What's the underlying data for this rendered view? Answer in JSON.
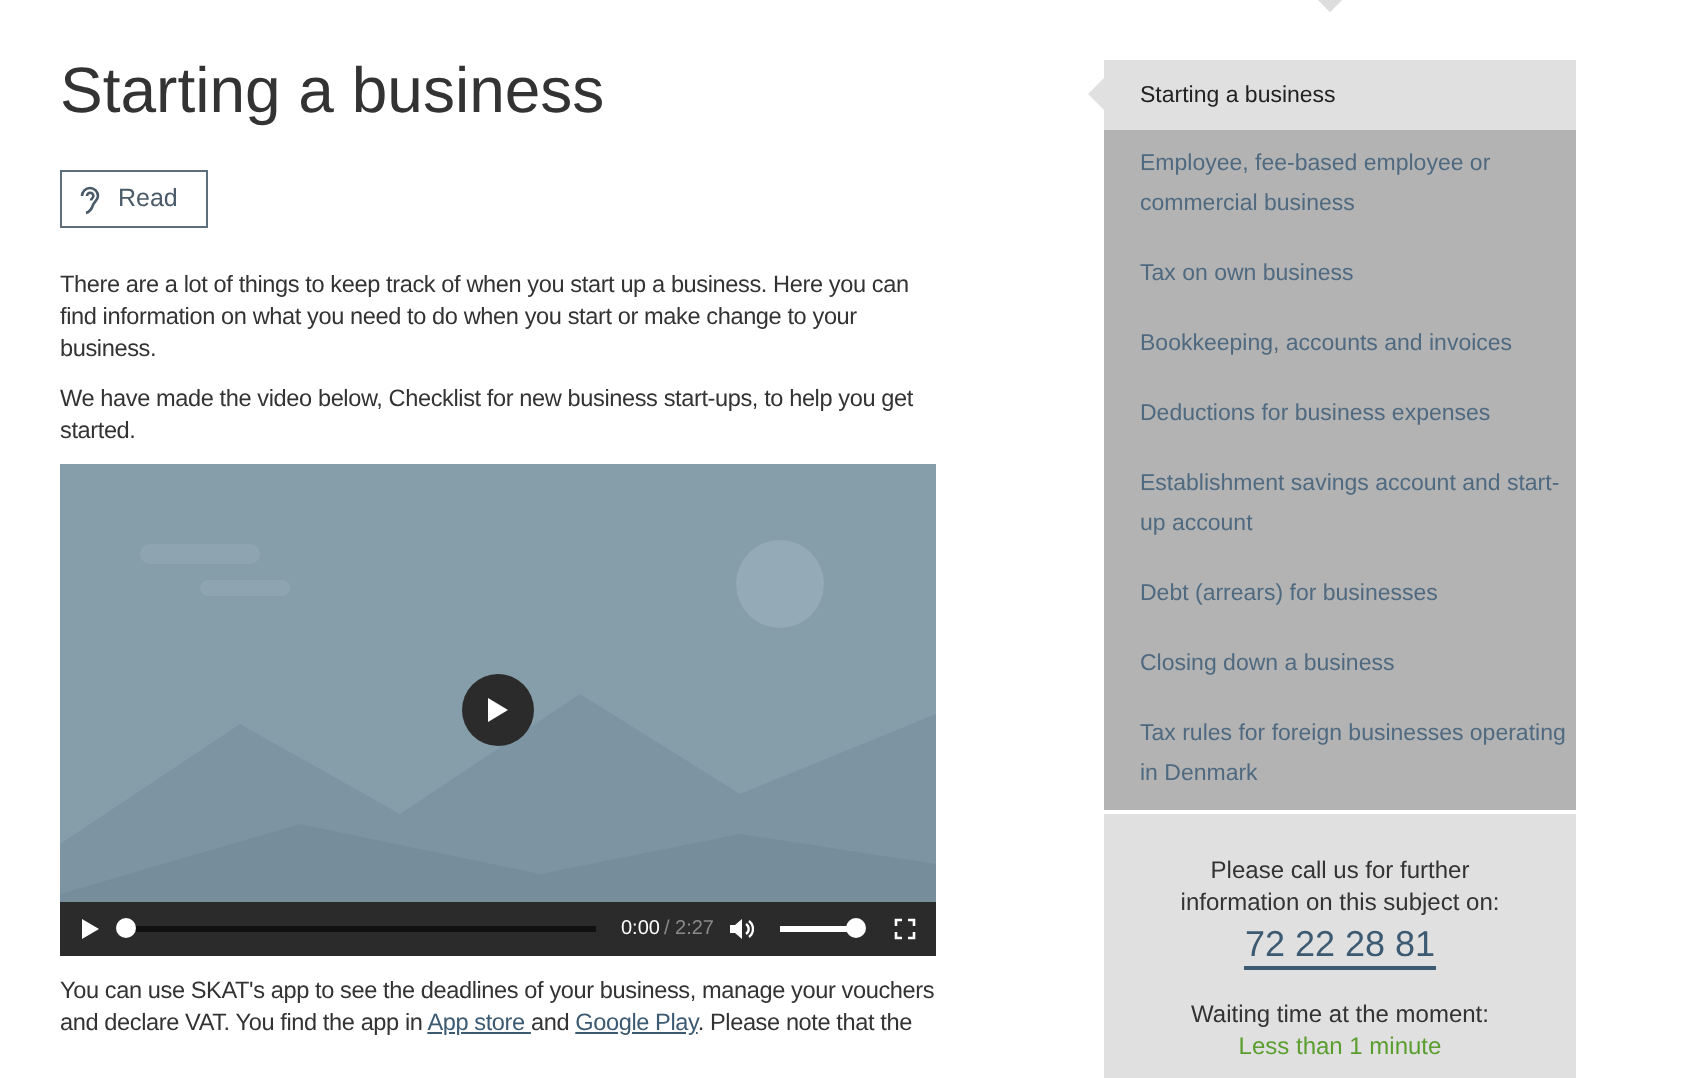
{
  "page": {
    "title": "Starting a business",
    "read_button": "Read",
    "paragraphs": [
      "There are a lot of things to keep track of when you start up a business. Here you can find information on what you need to do when you start or make change to your business.",
      "We have made the video below, Checklist for new business start-ups, to help you get started."
    ],
    "app_paragraph": [
      {
        "kind": "text",
        "text": "You can use SKAT's app to see the deadlines of your business, manage your vouchers and declare VAT. You find the app in "
      },
      {
        "kind": "link",
        "text": "App store "
      },
      {
        "kind": "text",
        "text": "and "
      },
      {
        "kind": "link",
        "text": "Google Play"
      },
      {
        "kind": "text",
        "text": ". Please note that the"
      }
    ]
  },
  "video": {
    "kind": "picture",
    "progress": {
      "level": 0.0
    },
    "current_time": "0:00",
    "duration": "/ 2:27",
    "volume": {
      "level": 1.0
    }
  },
  "sidebar": {
    "items": [
      {
        "label": "Starting a business",
        "selected": true
      },
      {
        "label": "Employee, fee-based employee or commercial business",
        "selected": false
      },
      {
        "label": "Tax on own business",
        "selected": false
      },
      {
        "label": "Bookkeeping, accounts and invoices",
        "selected": false
      },
      {
        "label": "Deductions for business expenses",
        "selected": false
      },
      {
        "label": "Establishment savings account and start-up account",
        "selected": false
      },
      {
        "label": "Debt (arrears) for businesses",
        "selected": false
      },
      {
        "label": "Closing down a business",
        "selected": false
      },
      {
        "label": "Tax rules for foreign businesses operating in Denmark",
        "selected": false
      }
    ]
  },
  "contact": {
    "text": "Please call us for further information on this subject on:",
    "phone": "72 22 28 81",
    "waiting_label": "Waiting time at the moment:",
    "waiting_value": "Less than 1 minute"
  }
}
